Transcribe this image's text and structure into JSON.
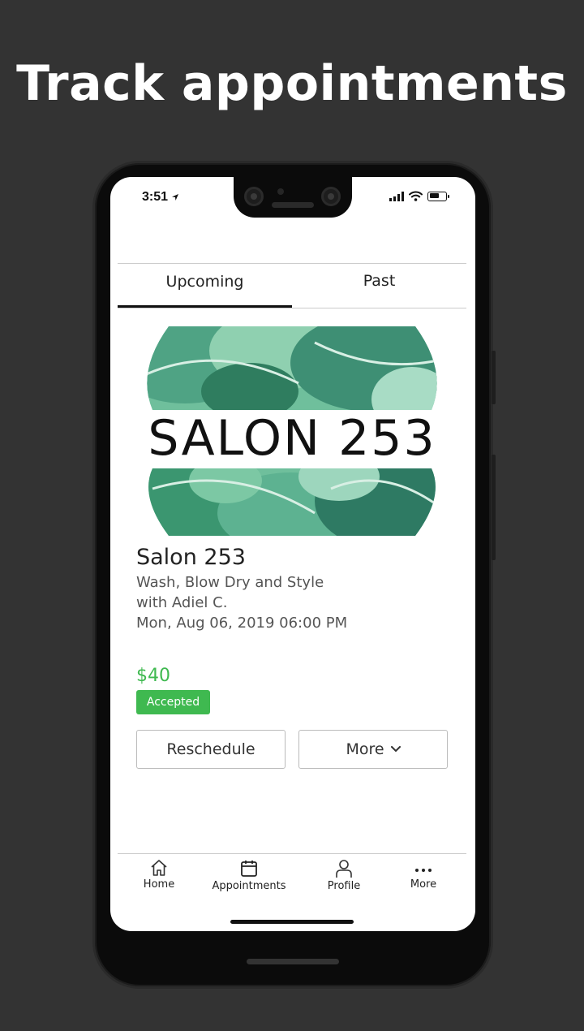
{
  "headline": "Track appointments",
  "status_bar": {
    "time": "3:51"
  },
  "tabs": [
    {
      "label": "Upcoming",
      "active": true
    },
    {
      "label": "Past",
      "active": false
    }
  ],
  "appointment": {
    "logo_text": "SALON 253",
    "salon_name": "Salon 253",
    "service": "Wash, Blow Dry and Style",
    "stylist": "with Adiel C.",
    "datetime": "Mon, Aug 06, 2019 06:00 PM",
    "price": "$40",
    "status": "Accepted",
    "status_color": "#3fb950"
  },
  "actions": {
    "reschedule_label": "Reschedule",
    "more_label": "More"
  },
  "bottom_nav": {
    "home": {
      "label": "Home",
      "icon": "home-icon"
    },
    "appointments": {
      "label": "Appointments",
      "icon": "calendar-icon"
    },
    "profile": {
      "label": "Profile",
      "icon": "person-icon"
    },
    "more": {
      "label": "More",
      "icon": "ellipsis-icon"
    }
  },
  "colors": {
    "background": "#333333",
    "accent_green": "#3fb950"
  }
}
